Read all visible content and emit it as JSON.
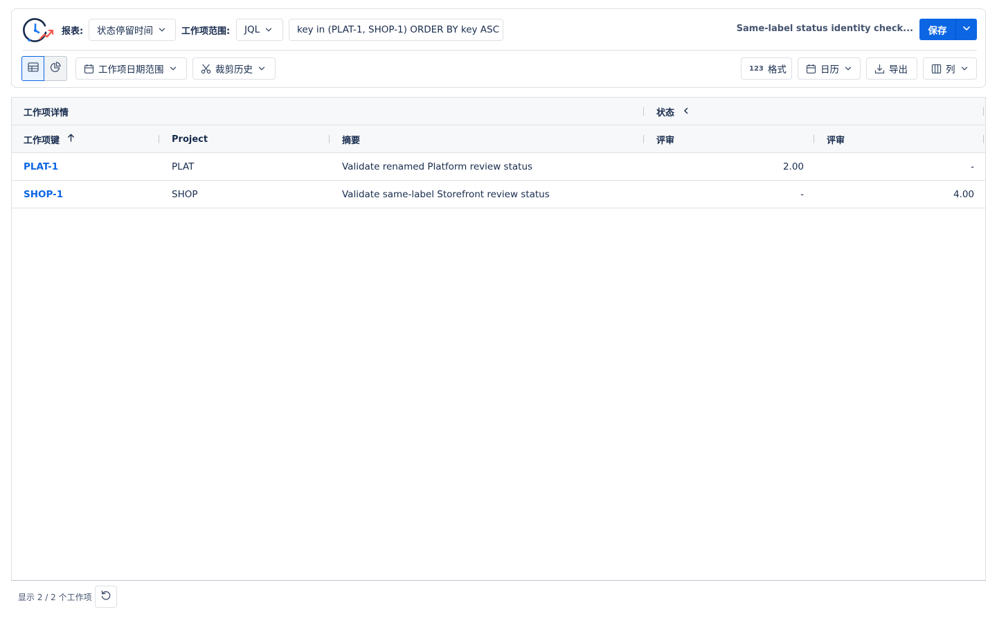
{
  "toolbar": {
    "report_label": "报表:",
    "report_value": "状态停留时间",
    "scope_label": "工作项范围:",
    "scope_value": "JQL",
    "jql_query": "key in (PLAT-1, SHOP-1) ORDER BY key ASC",
    "saved_report_name": "Same-label status identity check...",
    "save_label": "保存",
    "date_range_label": "工作项日期范围",
    "trim_history_label": "裁剪历史",
    "format_label": "格式",
    "format_icon_text": "123",
    "calendar_label": "日历",
    "export_label": "导出",
    "columns_label": "列"
  },
  "table": {
    "group_headers": {
      "details": "工作项详情",
      "status": "状态"
    },
    "columns": [
      "工作项键",
      "Project",
      "摘要",
      "评审",
      "评审"
    ],
    "rows": [
      {
        "key": "PLAT-1",
        "project": "PLAT",
        "summary": "Validate renamed Platform review status",
        "review_a": "2.00",
        "review_b": "-"
      },
      {
        "key": "SHOP-1",
        "project": "SHOP",
        "summary": "Validate same-label Storefront review status",
        "review_a": "-",
        "review_b": "4.00"
      }
    ]
  },
  "footer": {
    "count_text": "显示 2 / 2 个工作项"
  },
  "colors": {
    "accent": "#0c66e4",
    "border": "#dcdfe4",
    "header_bg": "#f7f8f9",
    "text": "#172b4d"
  }
}
